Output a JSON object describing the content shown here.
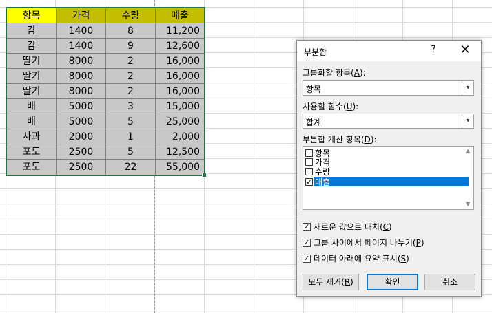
{
  "sheet": {
    "headers": [
      "항목",
      "가격",
      "수량",
      "매출"
    ],
    "rows": [
      [
        "감",
        "1400",
        "8",
        "11,200"
      ],
      [
        "감",
        "1400",
        "9",
        "12,600"
      ],
      [
        "딸기",
        "8000",
        "2",
        "16,000"
      ],
      [
        "딸기",
        "8000",
        "2",
        "16,000"
      ],
      [
        "딸기",
        "8000",
        "2",
        "16,000"
      ],
      [
        "배",
        "5000",
        "3",
        "15,000"
      ],
      [
        "배",
        "5000",
        "5",
        "25,000"
      ],
      [
        "사과",
        "2000",
        "1",
        "2,000"
      ],
      [
        "포도",
        "2500",
        "5",
        "12,500"
      ],
      [
        "포도",
        "2500",
        "22",
        "55,000"
      ]
    ]
  },
  "dialog": {
    "title": "부분합",
    "help": "?",
    "close": "✕",
    "group_label": "그룹화할 항목(",
    "group_key": "A",
    "group_value": "항목",
    "func_label": "사용할 함수(",
    "func_key": "U",
    "func_value": "합계",
    "calc_label": "부분합 계산 항목(",
    "calc_key": "D",
    "calc_items": [
      {
        "label": "항목",
        "checked": false
      },
      {
        "label": "가격",
        "checked": false
      },
      {
        "label": "수량",
        "checked": false
      },
      {
        "label": "매출",
        "checked": true
      }
    ],
    "options": [
      {
        "label": "새로운 값으로 대치(",
        "key": "C",
        "checked": true
      },
      {
        "label": "그룹 사이에서 페이지 나누기(",
        "key": "P",
        "checked": true
      },
      {
        "label": "데이터 아래에 요약 표시(",
        "key": "S",
        "checked": true
      }
    ],
    "remove_all": "모두 제거(",
    "remove_key": "R",
    "ok": "확인",
    "cancel": "취소",
    "close_paren": ")",
    "colon": "):",
    "check_mark": "✓",
    "arrow_down": "▾",
    "scroll_up": "▲",
    "scroll_down": "▼"
  }
}
